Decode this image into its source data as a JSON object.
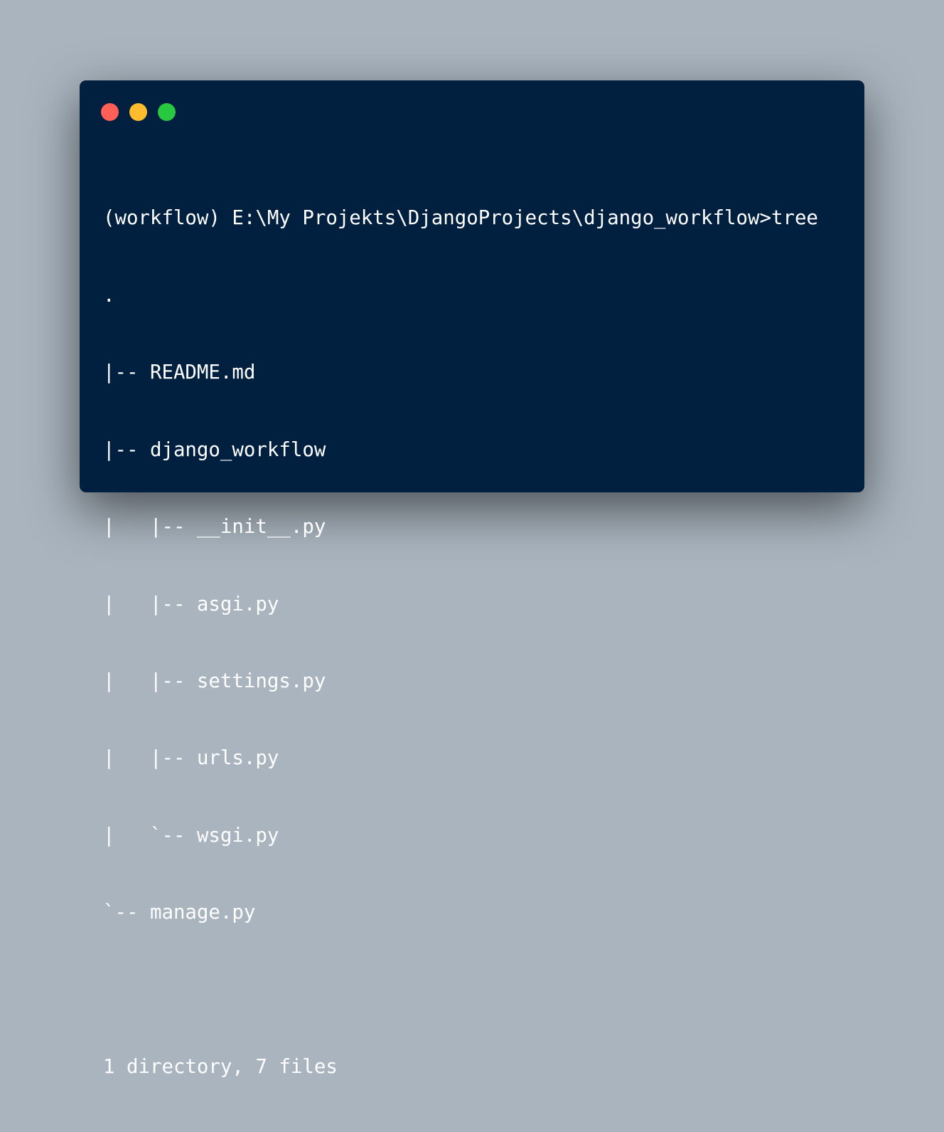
{
  "window": {
    "controls": [
      {
        "name": "close-button",
        "color": "#ff5f57"
      },
      {
        "name": "minimize-button",
        "color": "#febc2e"
      },
      {
        "name": "zoom-button",
        "color": "#28c840"
      }
    ]
  },
  "terminal": {
    "prompt_line": "(workflow) E:\\My Projekts\\DjangoProjects\\django_workflow>tree",
    "tree_lines": [
      ".",
      "|-- README.md",
      "|-- django_workflow",
      "|   |-- __init__.py",
      "|   |-- asgi.py",
      "|   |-- settings.py",
      "|   |-- urls.py",
      "|   `-- wsgi.py",
      "`-- manage.py"
    ],
    "blank_line": "",
    "summary_line": "1 directory, 7 files"
  },
  "colors": {
    "background": "#a9b4be",
    "window": "#012040",
    "text": "#ffffff"
  }
}
